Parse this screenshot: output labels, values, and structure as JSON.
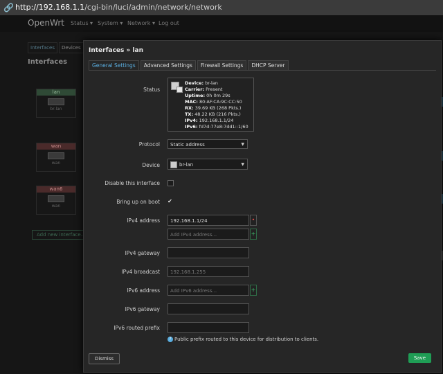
{
  "browser": {
    "url_host": "http://192.168.1.1",
    "url_path": "/cgi-bin/luci/admin/network/network"
  },
  "header": {
    "brand": "OpenWrt",
    "nav": [
      {
        "label": "Status ▾"
      },
      {
        "label": "System ▾"
      },
      {
        "label": "Network ▾"
      },
      {
        "label": "Log out"
      }
    ]
  },
  "background": {
    "tabs": [
      {
        "label": "Interfaces"
      },
      {
        "label": "Devices"
      }
    ],
    "title": "Interfaces",
    "interfaces": [
      {
        "name": "lan",
        "device": "br-lan"
      },
      {
        "name": "wan",
        "device": "wan"
      },
      {
        "name": "wan6",
        "device": "wan"
      }
    ],
    "add_button": "Add new interface..."
  },
  "modal": {
    "title": "Interfaces » lan",
    "tabs": [
      {
        "label": "General Settings",
        "active": true
      },
      {
        "label": "Advanced Settings"
      },
      {
        "label": "Firewall Settings"
      },
      {
        "label": "DHCP Server"
      }
    ],
    "status_label": "Status",
    "status": {
      "device_k": "Device:",
      "device_v": "br-lan",
      "carrier_k": "Carrier:",
      "carrier_v": "Present",
      "uptime_k": "Uptime:",
      "uptime_v": "0h 0m 29s",
      "mac_k": "MAC:",
      "mac_v": "80:AF:CA:9C:CC:50",
      "rx_k": "RX:",
      "rx_v": "39.69 KB (268 Pkts.)",
      "tx_k": "TX:",
      "tx_v": "48.22 KB (216 Pkts.)",
      "ipv4_k": "IPv4:",
      "ipv4_v": "192.168.1.1/24",
      "ipv6_k": "IPv6:",
      "ipv6_v": "fd7d:77e8:7dd1::1/60"
    },
    "protocol_label": "Protocol",
    "protocol_value": "Static address",
    "device_label": "Device",
    "device_value": "br-lan",
    "disable_label": "Disable this interface",
    "disable_checked": false,
    "boot_label": "Bring up on boot",
    "boot_checked": true,
    "check_mark": "✔",
    "ipv4_address_label": "IPv4 address",
    "ipv4_address_value": "192.168.1.1/24",
    "ipv4_add_placeholder": "Add IPv4 address...",
    "ipv4_gateway_label": "IPv4 gateway",
    "ipv4_broadcast_label": "IPv4 broadcast",
    "ipv4_broadcast_placeholder": "192.168.1.255",
    "ipv6_address_label": "IPv6 address",
    "ipv6_add_placeholder": "Add IPv6 address...",
    "ipv6_gateway_label": "IPv6 gateway",
    "ipv6_prefix_label": "IPv6 routed prefix",
    "ipv6_prefix_help": "Public prefix routed to this device for distribution to clients.",
    "dismiss_label": "Dismiss",
    "save_label": "Save"
  },
  "colors": {
    "accent": "#5aaee0",
    "save": "#1f9d55",
    "remove": "#e04848",
    "add": "#3fbf6e"
  }
}
